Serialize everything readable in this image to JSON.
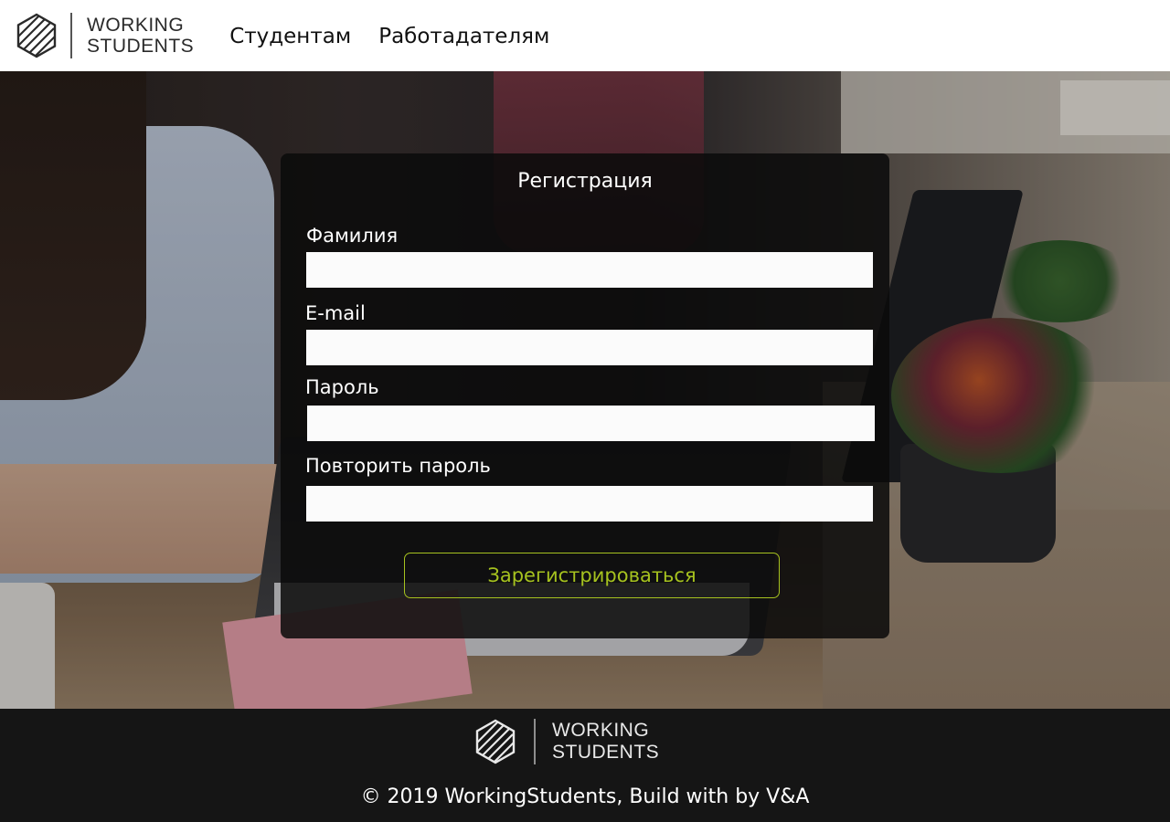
{
  "brand": {
    "line1": "WORKING",
    "line2": "STUDENTS"
  },
  "nav": {
    "items": [
      "Студентам",
      "Работадателям"
    ]
  },
  "form": {
    "title": "Регистрация",
    "fields": [
      {
        "label": "Фамилия",
        "value": ""
      },
      {
        "label": "E-mail",
        "value": ""
      },
      {
        "label": "Пароль",
        "value": ""
      },
      {
        "label": "Повторить пароль",
        "value": ""
      }
    ],
    "submit_label": "Зарегистрироваться"
  },
  "footer": {
    "copyright": "© 2019 WorkingStudents, Build with by V&A"
  },
  "colors": {
    "accent": "#a6c21f",
    "header_bg": "#ffffff",
    "footer_bg": "#151515",
    "form_bg": "#0a0a0a"
  },
  "icons": {
    "logo": "hexagon-stripes-logo-icon"
  }
}
